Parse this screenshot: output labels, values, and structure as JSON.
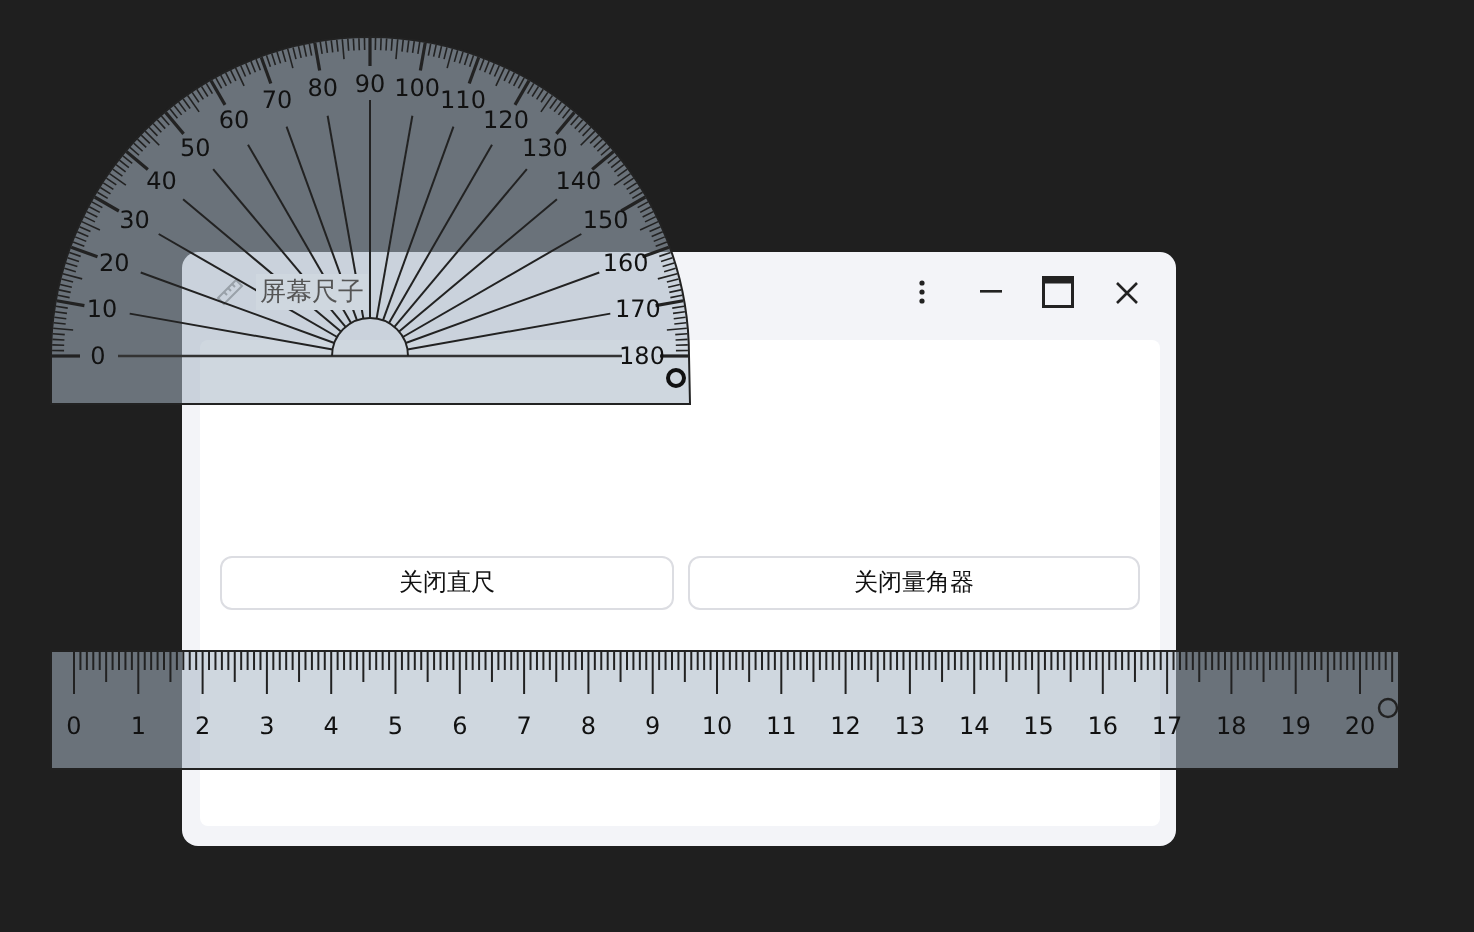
{
  "window": {
    "title": "屏幕尺子",
    "title_bar_buttons": [
      {
        "kind": "more"
      },
      {
        "kind": "minimize"
      },
      {
        "kind": "maximize"
      },
      {
        "kind": "close"
      }
    ],
    "buttons": [
      {
        "label": "关闭直尺"
      },
      {
        "label": "关闭量角器"
      }
    ]
  },
  "protractor": {
    "left_labels": [
      "80",
      "70",
      "60",
      "50",
      "40",
      "30",
      "20",
      "10",
      "0"
    ],
    "top_label": "90",
    "right_labels": [
      "100",
      "110",
      "120",
      "130",
      "140",
      "150",
      "160",
      "170",
      "180"
    ]
  },
  "ruler": {
    "labels": [
      "0",
      "1",
      "2",
      "3",
      "4",
      "5",
      "6",
      "7",
      "8",
      "9",
      "10",
      "11",
      "12",
      "13",
      "14",
      "15",
      "16",
      "17",
      "18",
      "19",
      "20"
    ]
  }
}
